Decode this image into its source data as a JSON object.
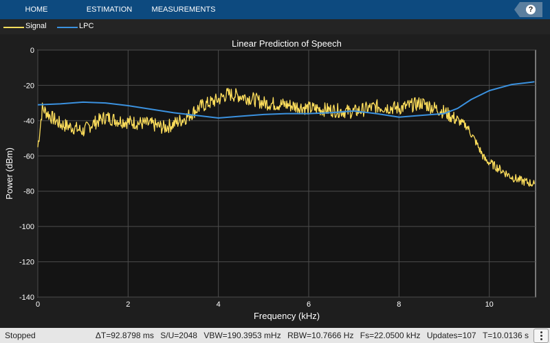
{
  "toolstrip": {
    "tabs": [
      {
        "label": "HOME"
      },
      {
        "label": "ESTIMATION"
      },
      {
        "label": "MEASUREMENTS"
      }
    ],
    "help_label": "?",
    "help_icon": "help-icon"
  },
  "legend": {
    "items": [
      {
        "label": "Signal",
        "color": "#ffdf5c"
      },
      {
        "label": "LPC",
        "color": "#3b92e0"
      }
    ]
  },
  "chart_data": {
    "type": "line",
    "title": "Linear Prediction of Speech",
    "xlabel": "Frequency (kHz)",
    "ylabel": "Power (dBm)",
    "xlim": [
      0,
      11.025
    ],
    "ylim": [
      -140,
      0
    ],
    "xticks": [
      "0",
      "2",
      "4",
      "6",
      "8",
      "10"
    ],
    "yticks": [
      "0",
      "-20",
      "-40",
      "-60",
      "-80",
      "-100",
      "-120",
      "-140"
    ],
    "grid": true,
    "legend_placement": "top-left",
    "background": "#141414",
    "series": [
      {
        "name": "Signal",
        "color": "#ffdf5c",
        "x": [
          0,
          0.1,
          0.3,
          0.5,
          0.8,
          1.0,
          1.2,
          1.5,
          1.8,
          2.1,
          2.5,
          2.8,
          3.0,
          3.3,
          3.6,
          3.8,
          4.0,
          4.2,
          4.5,
          4.8,
          5.0,
          5.5,
          6.0,
          6.5,
          7.0,
          7.5,
          8.0,
          8.5,
          9.0,
          9.3,
          9.5,
          9.7,
          9.9,
          10.2,
          10.5,
          10.7,
          11.0
        ],
        "y": [
          -55,
          -33,
          -38,
          -42,
          -44,
          -46,
          -42,
          -38,
          -40,
          -41,
          -42,
          -44,
          -42,
          -38,
          -32,
          -30,
          -28,
          -25,
          -26,
          -28,
          -30,
          -31,
          -33,
          -34,
          -35,
          -32,
          -33,
          -30,
          -35,
          -40,
          -43,
          -52,
          -62,
          -67,
          -72,
          -74,
          -76
        ]
      },
      {
        "name": "LPC",
        "color": "#3b92e0",
        "x": [
          0,
          0.5,
          1.0,
          1.5,
          2.0,
          2.5,
          3.0,
          3.5,
          4.0,
          4.5,
          5.0,
          5.5,
          6.0,
          6.5,
          7.0,
          7.5,
          8.0,
          8.5,
          9.0,
          9.3,
          9.6,
          10.0,
          10.5,
          11.0
        ],
        "y": [
          -31,
          -30.5,
          -29.5,
          -30,
          -31.5,
          -33.5,
          -35.5,
          -37,
          -38.5,
          -37.5,
          -36.5,
          -36,
          -36,
          -35.5,
          -34.5,
          -36,
          -38,
          -37,
          -36,
          -33,
          -28,
          -23,
          -19.5,
          -18
        ]
      }
    ]
  },
  "status": {
    "state": "Stopped",
    "dt": "ΔT=92.8798 ms",
    "su": "S/U=2048",
    "vbw": "VBW=190.3953 mHz",
    "rbw": "RBW=10.7666 Hz",
    "fs": "Fs=22.0500 kHz",
    "updates": "Updates=107",
    "t": "T=10.0136 s",
    "menu_icon": "vertical-ellipsis-icon"
  }
}
